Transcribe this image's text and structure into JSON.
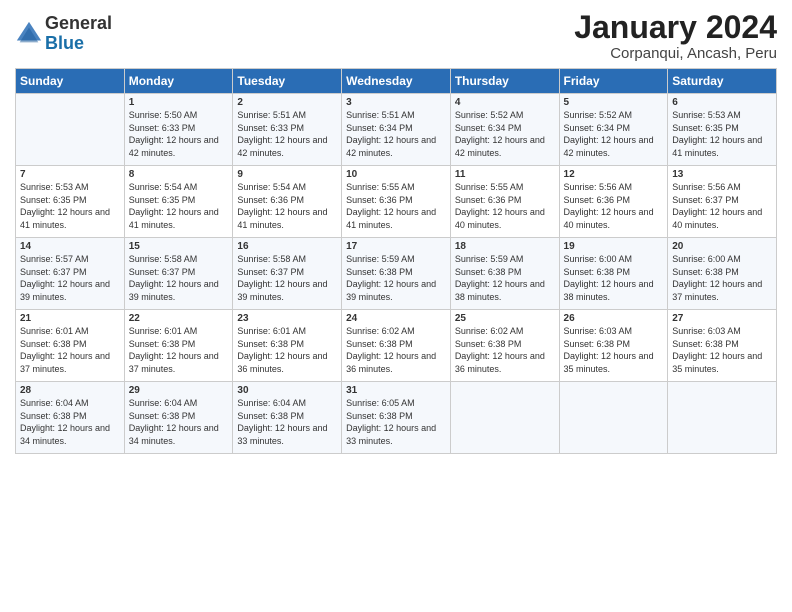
{
  "logo": {
    "general": "General",
    "blue": "Blue"
  },
  "header": {
    "title": "January 2024",
    "subtitle": "Corpanqui, Ancash, Peru"
  },
  "columns": [
    "Sunday",
    "Monday",
    "Tuesday",
    "Wednesday",
    "Thursday",
    "Friday",
    "Saturday"
  ],
  "weeks": [
    [
      {
        "day": "",
        "info": ""
      },
      {
        "day": "1",
        "info": "Sunrise: 5:50 AM\nSunset: 6:33 PM\nDaylight: 12 hours\nand 42 minutes."
      },
      {
        "day": "2",
        "info": "Sunrise: 5:51 AM\nSunset: 6:33 PM\nDaylight: 12 hours\nand 42 minutes."
      },
      {
        "day": "3",
        "info": "Sunrise: 5:51 AM\nSunset: 6:34 PM\nDaylight: 12 hours\nand 42 minutes."
      },
      {
        "day": "4",
        "info": "Sunrise: 5:52 AM\nSunset: 6:34 PM\nDaylight: 12 hours\nand 42 minutes."
      },
      {
        "day": "5",
        "info": "Sunrise: 5:52 AM\nSunset: 6:34 PM\nDaylight: 12 hours\nand 42 minutes."
      },
      {
        "day": "6",
        "info": "Sunrise: 5:53 AM\nSunset: 6:35 PM\nDaylight: 12 hours\nand 41 minutes."
      }
    ],
    [
      {
        "day": "7",
        "info": "Sunrise: 5:53 AM\nSunset: 6:35 PM\nDaylight: 12 hours\nand 41 minutes."
      },
      {
        "day": "8",
        "info": "Sunrise: 5:54 AM\nSunset: 6:35 PM\nDaylight: 12 hours\nand 41 minutes."
      },
      {
        "day": "9",
        "info": "Sunrise: 5:54 AM\nSunset: 6:36 PM\nDaylight: 12 hours\nand 41 minutes."
      },
      {
        "day": "10",
        "info": "Sunrise: 5:55 AM\nSunset: 6:36 PM\nDaylight: 12 hours\nand 41 minutes."
      },
      {
        "day": "11",
        "info": "Sunrise: 5:55 AM\nSunset: 6:36 PM\nDaylight: 12 hours\nand 40 minutes."
      },
      {
        "day": "12",
        "info": "Sunrise: 5:56 AM\nSunset: 6:36 PM\nDaylight: 12 hours\nand 40 minutes."
      },
      {
        "day": "13",
        "info": "Sunrise: 5:56 AM\nSunset: 6:37 PM\nDaylight: 12 hours\nand 40 minutes."
      }
    ],
    [
      {
        "day": "14",
        "info": "Sunrise: 5:57 AM\nSunset: 6:37 PM\nDaylight: 12 hours\nand 39 minutes."
      },
      {
        "day": "15",
        "info": "Sunrise: 5:58 AM\nSunset: 6:37 PM\nDaylight: 12 hours\nand 39 minutes."
      },
      {
        "day": "16",
        "info": "Sunrise: 5:58 AM\nSunset: 6:37 PM\nDaylight: 12 hours\nand 39 minutes."
      },
      {
        "day": "17",
        "info": "Sunrise: 5:59 AM\nSunset: 6:38 PM\nDaylight: 12 hours\nand 39 minutes."
      },
      {
        "day": "18",
        "info": "Sunrise: 5:59 AM\nSunset: 6:38 PM\nDaylight: 12 hours\nand 38 minutes."
      },
      {
        "day": "19",
        "info": "Sunrise: 6:00 AM\nSunset: 6:38 PM\nDaylight: 12 hours\nand 38 minutes."
      },
      {
        "day": "20",
        "info": "Sunrise: 6:00 AM\nSunset: 6:38 PM\nDaylight: 12 hours\nand 37 minutes."
      }
    ],
    [
      {
        "day": "21",
        "info": "Sunrise: 6:01 AM\nSunset: 6:38 PM\nDaylight: 12 hours\nand 37 minutes."
      },
      {
        "day": "22",
        "info": "Sunrise: 6:01 AM\nSunset: 6:38 PM\nDaylight: 12 hours\nand 37 minutes."
      },
      {
        "day": "23",
        "info": "Sunrise: 6:01 AM\nSunset: 6:38 PM\nDaylight: 12 hours\nand 36 minutes."
      },
      {
        "day": "24",
        "info": "Sunrise: 6:02 AM\nSunset: 6:38 PM\nDaylight: 12 hours\nand 36 minutes."
      },
      {
        "day": "25",
        "info": "Sunrise: 6:02 AM\nSunset: 6:38 PM\nDaylight: 12 hours\nand 36 minutes."
      },
      {
        "day": "26",
        "info": "Sunrise: 6:03 AM\nSunset: 6:38 PM\nDaylight: 12 hours\nand 35 minutes."
      },
      {
        "day": "27",
        "info": "Sunrise: 6:03 AM\nSunset: 6:38 PM\nDaylight: 12 hours\nand 35 minutes."
      }
    ],
    [
      {
        "day": "28",
        "info": "Sunrise: 6:04 AM\nSunset: 6:38 PM\nDaylight: 12 hours\nand 34 minutes."
      },
      {
        "day": "29",
        "info": "Sunrise: 6:04 AM\nSunset: 6:38 PM\nDaylight: 12 hours\nand 34 minutes."
      },
      {
        "day": "30",
        "info": "Sunrise: 6:04 AM\nSunset: 6:38 PM\nDaylight: 12 hours\nand 33 minutes."
      },
      {
        "day": "31",
        "info": "Sunrise: 6:05 AM\nSunset: 6:38 PM\nDaylight: 12 hours\nand 33 minutes."
      },
      {
        "day": "",
        "info": ""
      },
      {
        "day": "",
        "info": ""
      },
      {
        "day": "",
        "info": ""
      }
    ]
  ]
}
